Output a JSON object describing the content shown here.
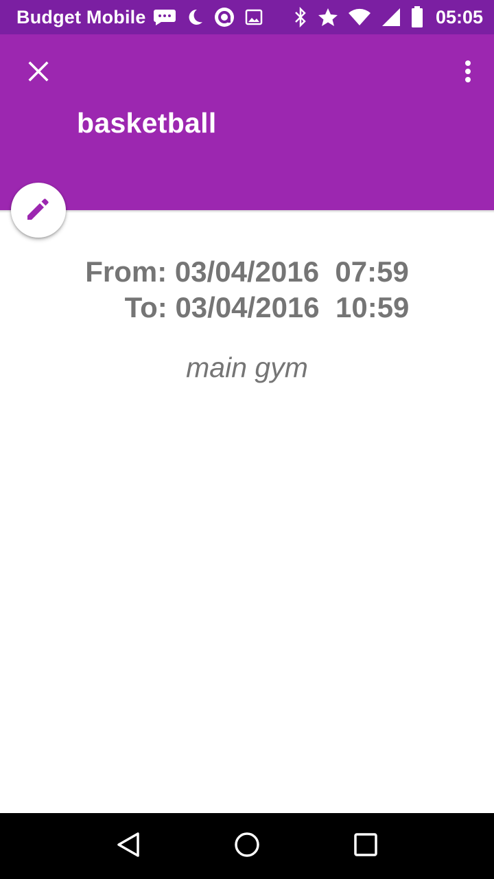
{
  "status_bar": {
    "carrier": "Budget Mobile",
    "time": "05:05",
    "icons": [
      "message-icon",
      "moon-icon",
      "sync-icon",
      "image-icon",
      "bluetooth-icon",
      "star-icon",
      "wifi-icon",
      "signal-icon",
      "battery-icon"
    ]
  },
  "app_bar": {
    "title": "basketball",
    "close_icon": "close-icon",
    "menu_icon": "more-vert-icon",
    "color": "#9c27b0"
  },
  "fab": {
    "icon": "edit-icon",
    "color": "#9c27b0"
  },
  "event": {
    "from_line": "From: 03/04/2016  07:59",
    "to_line": "To: 03/04/2016  10:59",
    "location": "main gym"
  },
  "nav_bar": {
    "icons": [
      "back-icon",
      "home-icon",
      "recents-icon"
    ]
  }
}
